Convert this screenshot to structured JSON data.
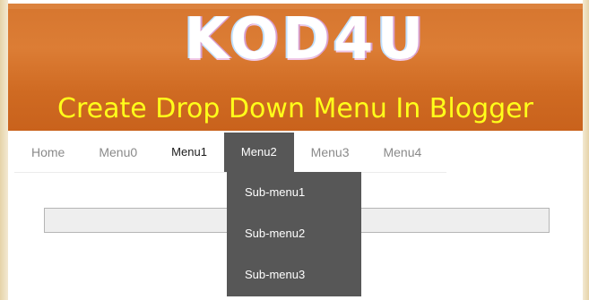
{
  "header": {
    "logo_text": "KOD4U",
    "tagline": "Create Drop Down Menu In Blogger"
  },
  "nav": {
    "items": [
      {
        "label": "Home"
      },
      {
        "label": "Menu0"
      },
      {
        "label": "Menu1"
      },
      {
        "label": "Menu2"
      },
      {
        "label": "Menu3"
      },
      {
        "label": "Menu4"
      }
    ],
    "active": "Menu2"
  },
  "dropdown": {
    "items": [
      {
        "label": "Sub-menu1"
      },
      {
        "label": "Sub-menu2"
      },
      {
        "label": "Sub-menu3"
      }
    ]
  },
  "colors": {
    "header_orange": "#d6762f",
    "tagline_yellow": "#ffff1a",
    "menu_dark": "#575757"
  }
}
